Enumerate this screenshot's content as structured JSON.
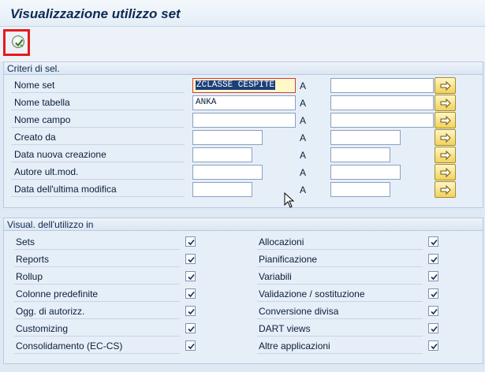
{
  "title": "Visualizzazione utilizzo set",
  "colors": {
    "accent": "#0d2a52",
    "highlight": "#e41b1b",
    "button": "#f1d25a"
  },
  "toolbar": {
    "execute_icon": "execute-icon"
  },
  "criteria": {
    "header": "Criteri di sel.",
    "to_label": "A",
    "rows": [
      {
        "label": "Nome set",
        "from": "ZCLASSE CESPITE",
        "to": ""
      },
      {
        "label": "Nome tabella",
        "from": "ANKA",
        "to": ""
      },
      {
        "label": "Nome campo",
        "from": "",
        "to": ""
      },
      {
        "label": "Creato da",
        "from": "",
        "to": ""
      },
      {
        "label": "Data nuova creazione",
        "from": "",
        "to": ""
      },
      {
        "label": "Autore ult.mod.",
        "from": "",
        "to": ""
      },
      {
        "label": "Data dell'ultima modifica",
        "from": "",
        "to": ""
      }
    ]
  },
  "usage": {
    "header": "Visual. dell'utilizzo in",
    "left": [
      {
        "label": "Sets",
        "checked": true
      },
      {
        "label": "Reports",
        "checked": true
      },
      {
        "label": "Rollup",
        "checked": true
      },
      {
        "label": "Colonne predefinite",
        "checked": true
      },
      {
        "label": "Ogg. di autorizz.",
        "checked": true
      },
      {
        "label": "Customizing",
        "checked": true
      },
      {
        "label": "Consolidamento (EC-CS)",
        "checked": true
      }
    ],
    "right": [
      {
        "label": "Allocazioni",
        "checked": true
      },
      {
        "label": "Pianificazione",
        "checked": true
      },
      {
        "label": "Variabili",
        "checked": true
      },
      {
        "label": "Validazione / sostituzione",
        "checked": true
      },
      {
        "label": "Conversione divisa",
        "checked": true
      },
      {
        "label": "DART views",
        "checked": true
      },
      {
        "label": "Altre applicazioni",
        "checked": true
      }
    ]
  }
}
